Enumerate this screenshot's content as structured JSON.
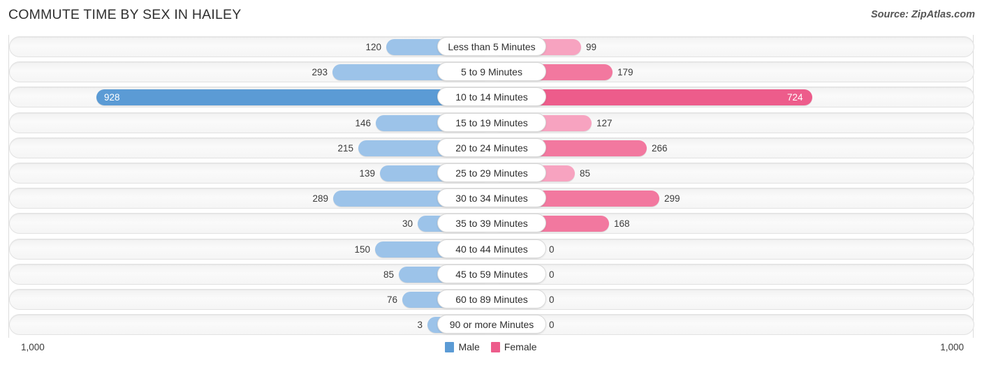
{
  "header": {
    "title": "COMMUTE TIME BY SEX IN HAILEY",
    "source": "Source: ZipAtlas.com"
  },
  "legend": {
    "male_label": "Male",
    "female_label": "Female",
    "male_color": "#5b9bd5",
    "female_color": "#ed5c8b"
  },
  "axis": {
    "left_label": "1,000",
    "right_label": "1,000",
    "max": 1000
  },
  "chart_data": {
    "type": "bar",
    "orientation": "horizontal-diverging",
    "title": "COMMUTE TIME BY SEX IN HAILEY",
    "xlabel": "",
    "ylabel": "",
    "xlim": [
      1000,
      1000
    ],
    "grid": false,
    "legend_position": "bottom-center",
    "categories": [
      "Less than 5 Minutes",
      "5 to 9 Minutes",
      "10 to 14 Minutes",
      "15 to 19 Minutes",
      "20 to 24 Minutes",
      "25 to 29 Minutes",
      "30 to 34 Minutes",
      "35 to 39 Minutes",
      "40 to 44 Minutes",
      "45 to 59 Minutes",
      "60 to 89 Minutes",
      "90 or more Minutes"
    ],
    "series": [
      {
        "name": "Male",
        "values": [
          120,
          293,
          928,
          146,
          215,
          139,
          289,
          30,
          150,
          85,
          76,
          3
        ]
      },
      {
        "name": "Female",
        "values": [
          99,
          179,
          724,
          127,
          266,
          85,
          299,
          168,
          0,
          0,
          0,
          0
        ]
      }
    ]
  },
  "rows": [
    {
      "label": "Less than 5 Minutes",
      "male": "120",
      "female": "99",
      "male_w": 151,
      "female_w": 128,
      "male_hi": false,
      "female_tone": "light",
      "male_inside": false,
      "female_inside": false
    },
    {
      "label": "5 to 9 Minutes",
      "male": "293",
      "female": "179",
      "male_w": 228,
      "female_w": 173,
      "male_hi": false,
      "female_tone": "mid",
      "male_inside": false,
      "female_inside": false
    },
    {
      "label": "10 to 14 Minutes",
      "male": "928",
      "female": "724",
      "male_w": 566,
      "female_w": 459,
      "male_hi": true,
      "female_tone": "hi",
      "male_inside": true,
      "female_inside": true
    },
    {
      "label": "15 to 19 Minutes",
      "male": "146",
      "female": "127",
      "male_w": 166,
      "female_w": 143,
      "male_hi": false,
      "female_tone": "light",
      "male_inside": false,
      "female_inside": false
    },
    {
      "label": "20 to 24 Minutes",
      "male": "215",
      "female": "266",
      "male_w": 191,
      "female_w": 222,
      "male_hi": false,
      "female_tone": "mid",
      "male_inside": false,
      "female_inside": false
    },
    {
      "label": "25 to 29 Minutes",
      "male": "139",
      "female": "85",
      "male_w": 160,
      "female_w": 119,
      "male_hi": false,
      "female_tone": "light",
      "male_inside": false,
      "female_inside": false
    },
    {
      "label": "30 to 34 Minutes",
      "male": "289",
      "female": "299",
      "male_w": 227,
      "female_w": 240,
      "male_hi": false,
      "female_tone": "mid",
      "male_inside": false,
      "female_inside": false
    },
    {
      "label": "35 to 39 Minutes",
      "male": "30",
      "female": "168",
      "male_w": 106,
      "female_w": 168,
      "male_hi": false,
      "female_tone": "mid",
      "male_inside": false,
      "female_inside": false
    },
    {
      "label": "40 to 44 Minutes",
      "male": "150",
      "female": "0",
      "male_w": 167,
      "female_w": 75,
      "male_hi": false,
      "female_tone": "mid",
      "male_inside": false,
      "female_inside": false
    },
    {
      "label": "45 to 59 Minutes",
      "male": "85",
      "female": "0",
      "male_w": 133,
      "female_w": 75,
      "male_hi": false,
      "female_tone": "mid",
      "male_inside": false,
      "female_inside": false
    },
    {
      "label": "60 to 89 Minutes",
      "male": "76",
      "female": "0",
      "male_w": 128,
      "female_w": 75,
      "male_hi": false,
      "female_tone": "mid",
      "male_inside": false,
      "female_inside": false
    },
    {
      "label": "90 or more Minutes",
      "male": "3",
      "female": "0",
      "male_w": 92,
      "female_w": 75,
      "male_hi": false,
      "female_tone": "mid",
      "male_inside": false,
      "female_inside": false
    }
  ]
}
